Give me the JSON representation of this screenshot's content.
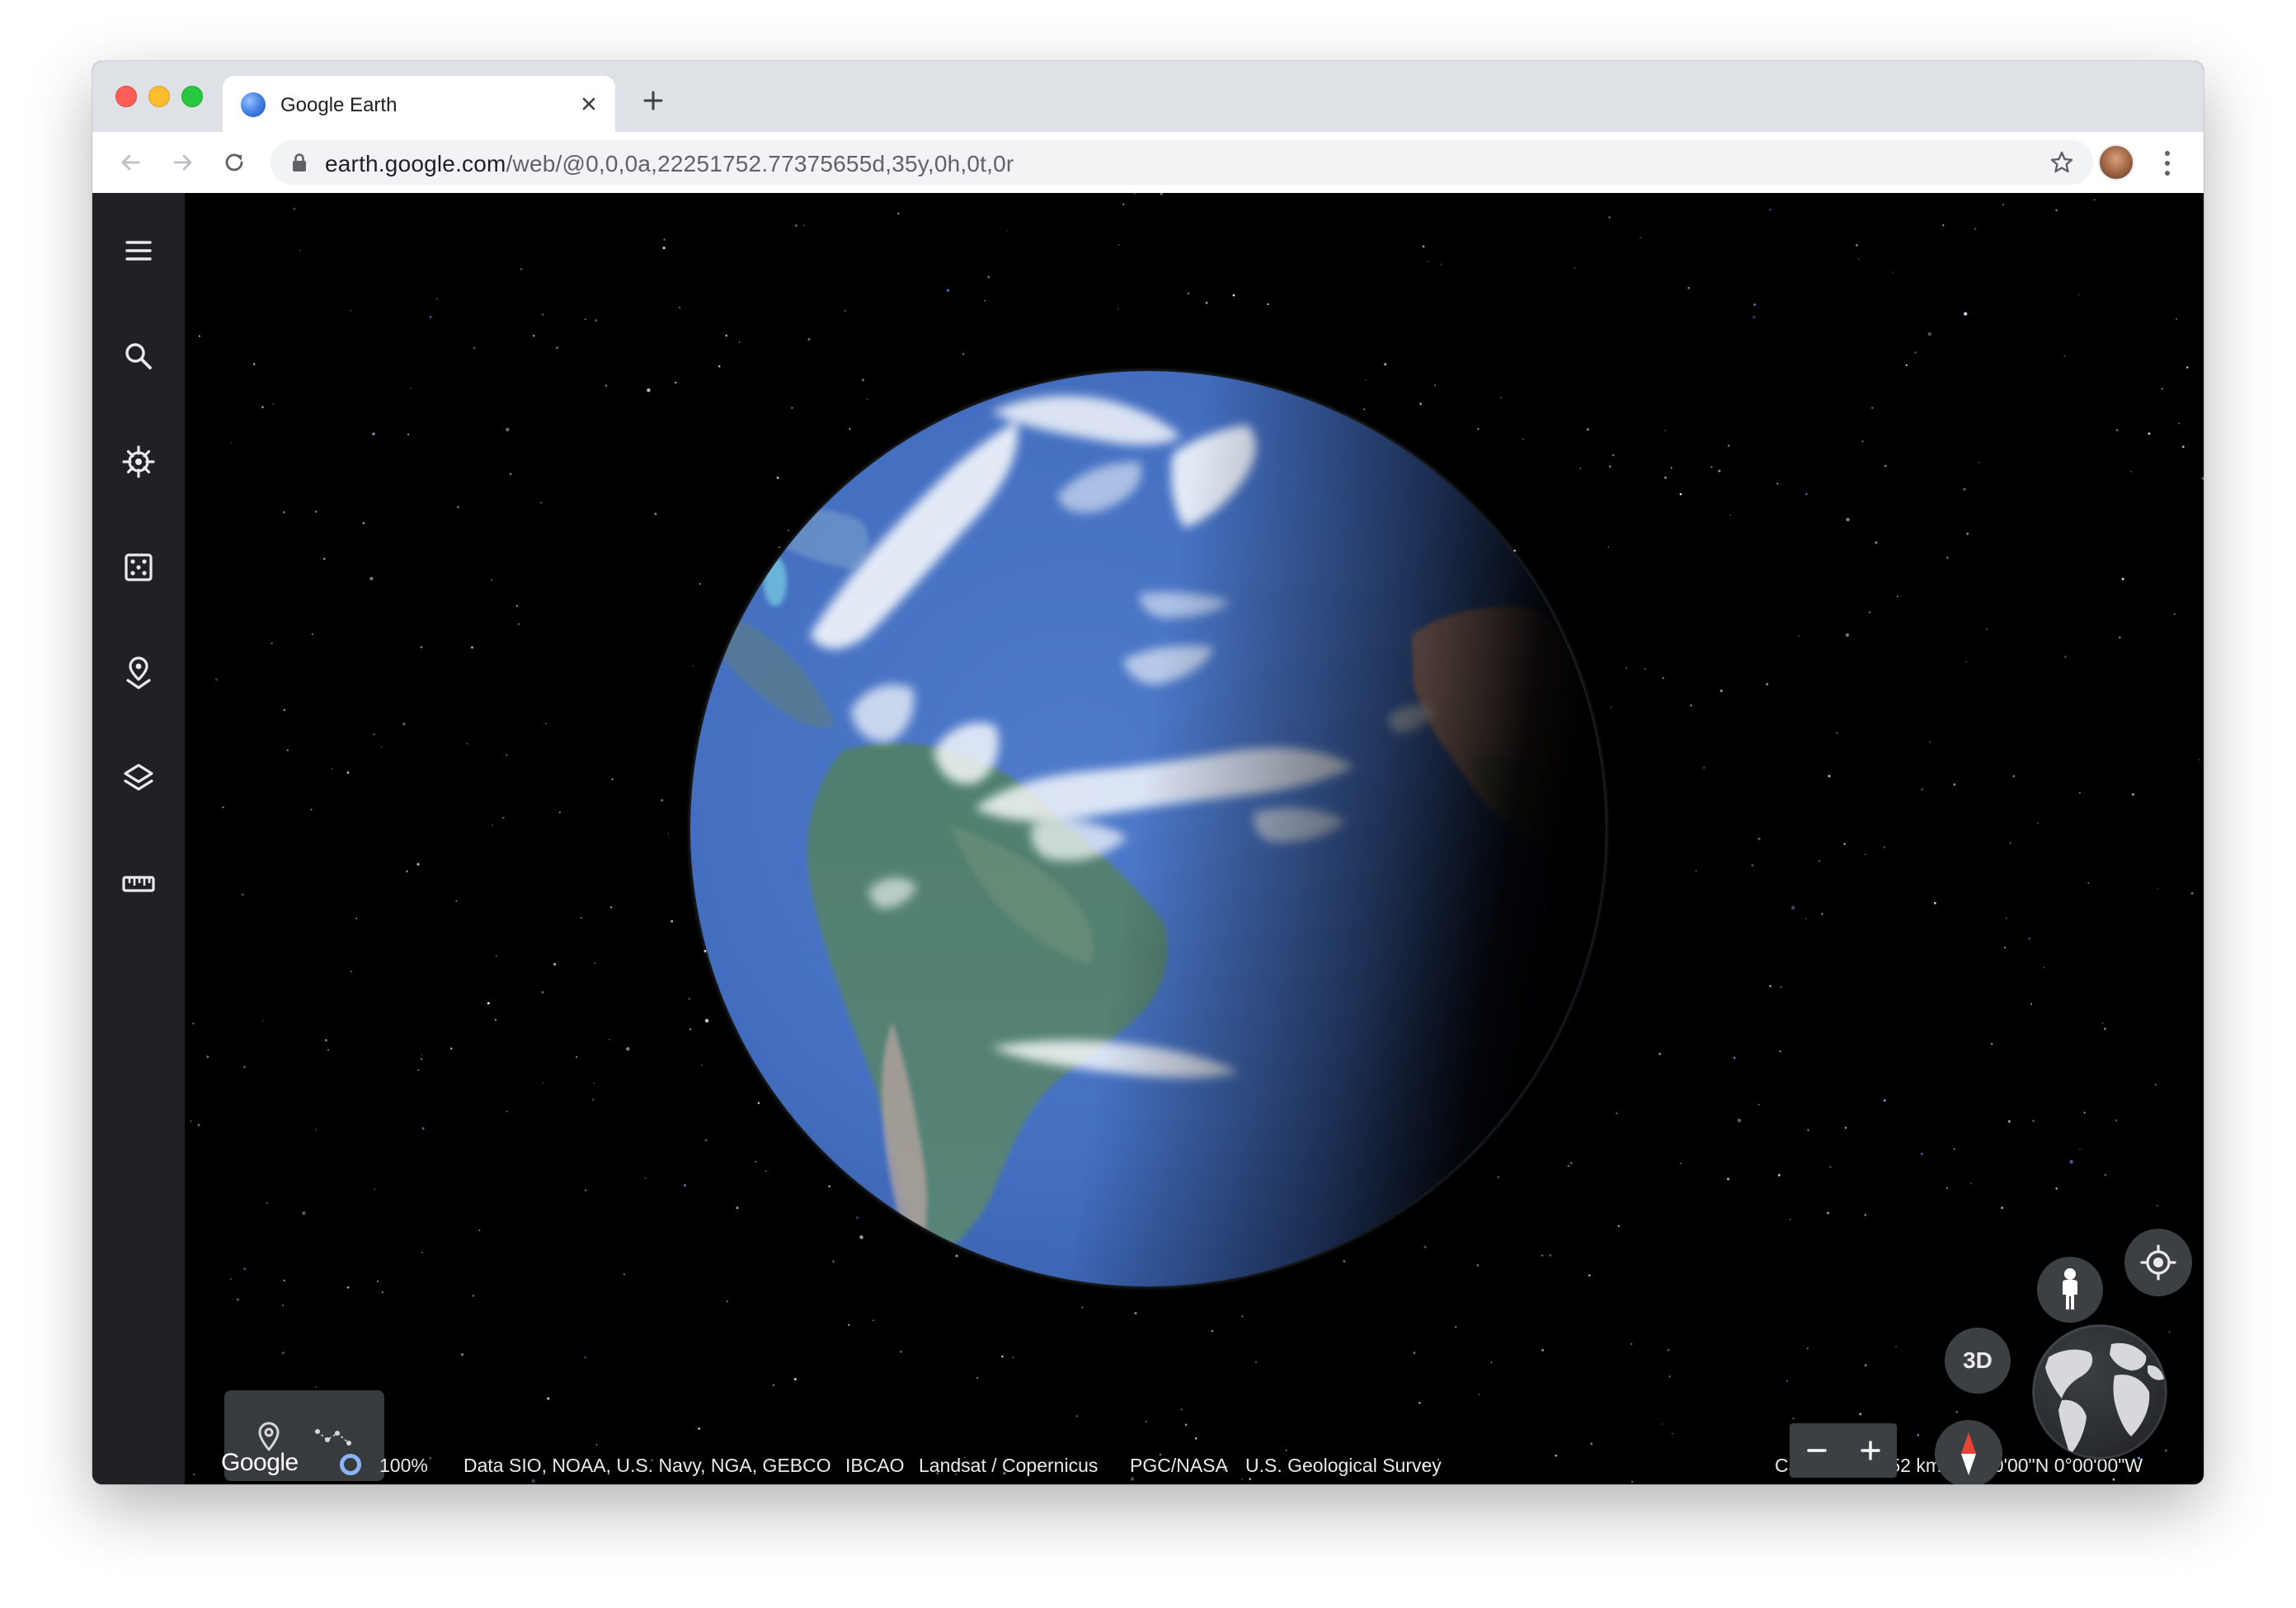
{
  "browser": {
    "tab": {
      "title": "Google Earth"
    },
    "address": {
      "host": "earth.google.com",
      "path": "/web/@0,0,0a,22251752.77375655d,35y,0h,0t,0r"
    }
  },
  "earth": {
    "left_rail": {
      "items": [
        {
          "icon": "menu-icon"
        },
        {
          "icon": "search-icon"
        },
        {
          "icon": "voyager-icon"
        },
        {
          "icon": "feeling-lucky-icon"
        },
        {
          "icon": "projects-icon"
        },
        {
          "icon": "map-style-icon"
        },
        {
          "icon": "measure-icon"
        }
      ]
    },
    "draw_tools": {
      "items": [
        {
          "icon": "add-placemark-icon"
        },
        {
          "icon": "draw-line-icon"
        }
      ]
    },
    "attribution": {
      "logo": "Google",
      "loading_percent": "100%",
      "credits": "Data SIO, NOAA, U.S. Navy, NGA, GEBCO",
      "credit_items": [
        "IBCAO",
        "Landsat / Copernicus",
        "PGC/NASA",
        "U.S. Geological Survey"
      ],
      "camera": "Camera: 22,252 km",
      "coordinates": "0°00'00\"N 0°00'00\"W"
    },
    "controls": {
      "view_toggle": "3D",
      "zoom_out": "−",
      "zoom_in": "+"
    }
  },
  "colors": {
    "rail_background": "#202124",
    "control_background": "#3c4043",
    "loading_ring": "#8ab4f8",
    "compass_north": "#ea4335",
    "ocean": "#4a74c4"
  }
}
